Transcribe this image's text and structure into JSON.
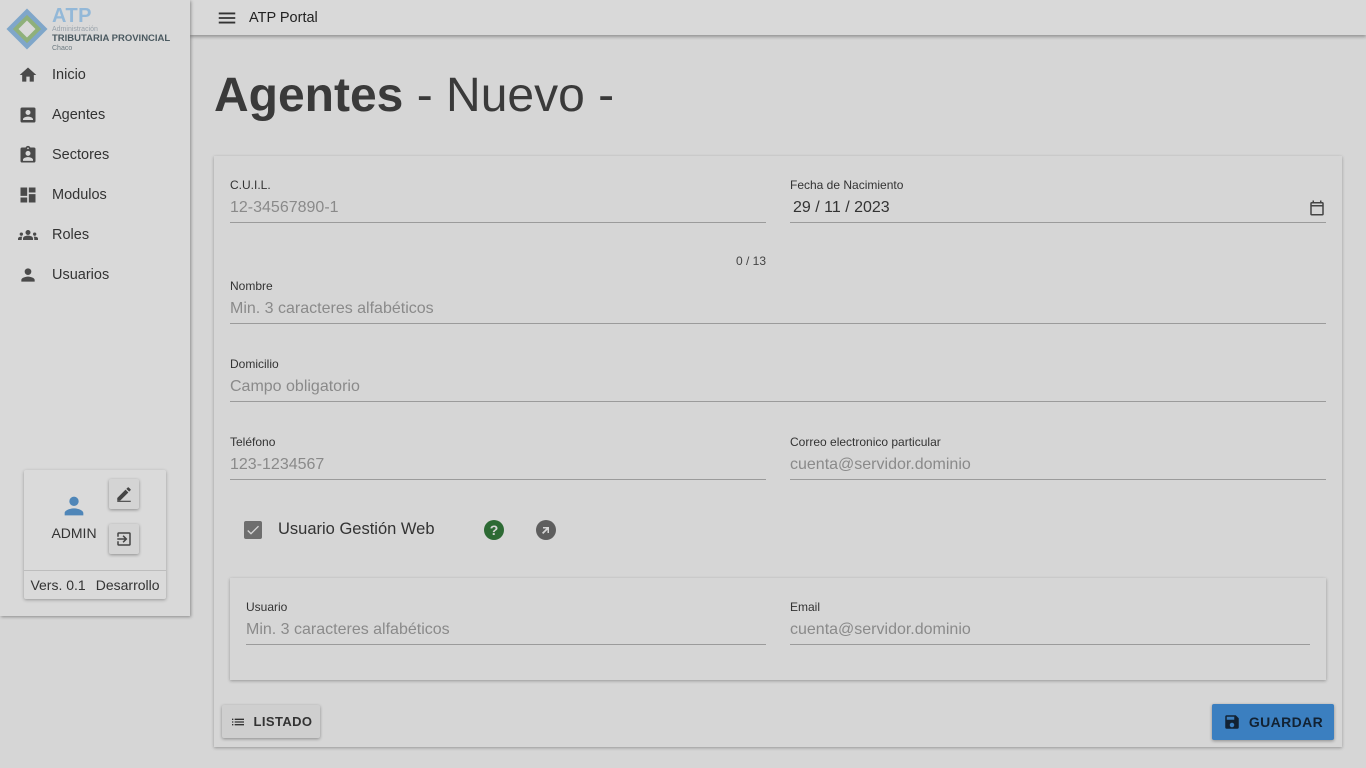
{
  "logo": {
    "main": "ATP",
    "line1": "Administración",
    "line2": "TRIBUTARIA PROVINCIAL",
    "line3": "Chaco"
  },
  "sidebar": {
    "items": [
      {
        "label": "Inicio",
        "icon": "home-icon"
      },
      {
        "label": "Agentes",
        "icon": "account-box-icon"
      },
      {
        "label": "Sectores",
        "icon": "badge-icon"
      },
      {
        "label": "Modulos",
        "icon": "dashboard-icon"
      },
      {
        "label": "Roles",
        "icon": "groups-icon"
      },
      {
        "label": "Usuarios",
        "icon": "person-icon"
      }
    ]
  },
  "user_card": {
    "name": "ADMIN",
    "version": "Vers. 0.1",
    "environment": "Desarrollo"
  },
  "topbar": {
    "title": "ATP Portal"
  },
  "page": {
    "title_strong": "Agentes",
    "title_light": " - Nuevo -"
  },
  "form": {
    "cuil": {
      "label": "C.U.I.L.",
      "placeholder": "12-34567890-1",
      "counter": "0 / 13"
    },
    "fecha_nacimiento": {
      "label": "Fecha de Nacimiento",
      "value": "29 / 11 / 2023"
    },
    "nombre": {
      "label": "Nombre",
      "placeholder": "Min. 3 caracteres alfabéticos"
    },
    "domicilio": {
      "label": "Domicilio",
      "placeholder": "Campo obligatorio"
    },
    "telefono": {
      "label": "Teléfono",
      "placeholder": "123-1234567"
    },
    "correo": {
      "label": "Correo electronico particular",
      "placeholder": "cuenta@servidor.dominio"
    },
    "usuario_gestion_web": {
      "label": "Usuario Gestión Web",
      "checked": true,
      "help": "?"
    },
    "usuario": {
      "label": "Usuario",
      "placeholder": "Min. 3 caracteres alfabéticos"
    },
    "email": {
      "label": "Email",
      "placeholder": "cuenta@servidor.dominio"
    }
  },
  "actions": {
    "listado": "LISTADO",
    "guardar": "GUARDAR"
  },
  "colors": {
    "accent": "#3b7fc0",
    "help": "#2d6a34"
  }
}
